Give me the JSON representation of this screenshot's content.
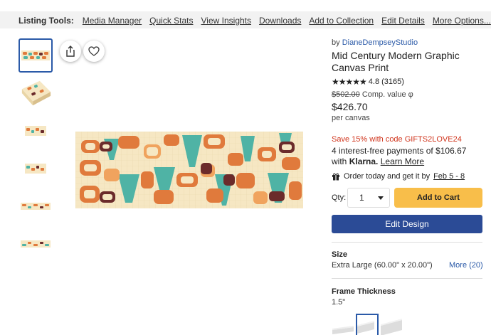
{
  "toolbar": {
    "label": "Listing Tools:",
    "links": [
      "Media Manager",
      "Quick Stats",
      "View Insights",
      "Downloads",
      "Add to Collection",
      "Edit Details",
      "More Options..."
    ]
  },
  "product": {
    "by_prefix": "by",
    "seller": "DianeDempseyStudio",
    "title": "Mid Century Modern Graphic Canvas Print",
    "rating": "4.8",
    "review_count": "(3165)",
    "stars": "★★★★★",
    "compare_price": "$502.00",
    "compare_label": "Comp. value",
    "compare_info_icon": "φ",
    "price": "$426.70",
    "per_unit": "per canvas",
    "promo": "Save 15% with code GIFTS2LOVE24",
    "klarna_text": "4 interest-free payments of $106.67 with",
    "klarna_brand": "Klarna.",
    "klarna_link": "Learn More",
    "delivery_text": "Order today and get it by",
    "delivery_date": "Feb 5 - 8"
  },
  "purchase": {
    "qty_label": "Qty:",
    "qty_value": "1",
    "add_to_cart": "Add to Cart",
    "edit_design": "Edit Design"
  },
  "options": {
    "size_label": "Size",
    "size_value": "Extra Large (60.00\" x 20.00\")",
    "size_more": "More (20)",
    "frame_label": "Frame Thickness",
    "frame_value": "1.5\""
  },
  "colors": {
    "accent_blue": "#2b5aa8",
    "edit_button": "#2b4b96",
    "cart_button": "#f8be4a",
    "promo_red": "#d0341c",
    "art_orange": "#e07a3c",
    "art_teal": "#4fb3a5",
    "art_brown": "#6b2b2b",
    "art_cream": "#f6e7c3"
  }
}
